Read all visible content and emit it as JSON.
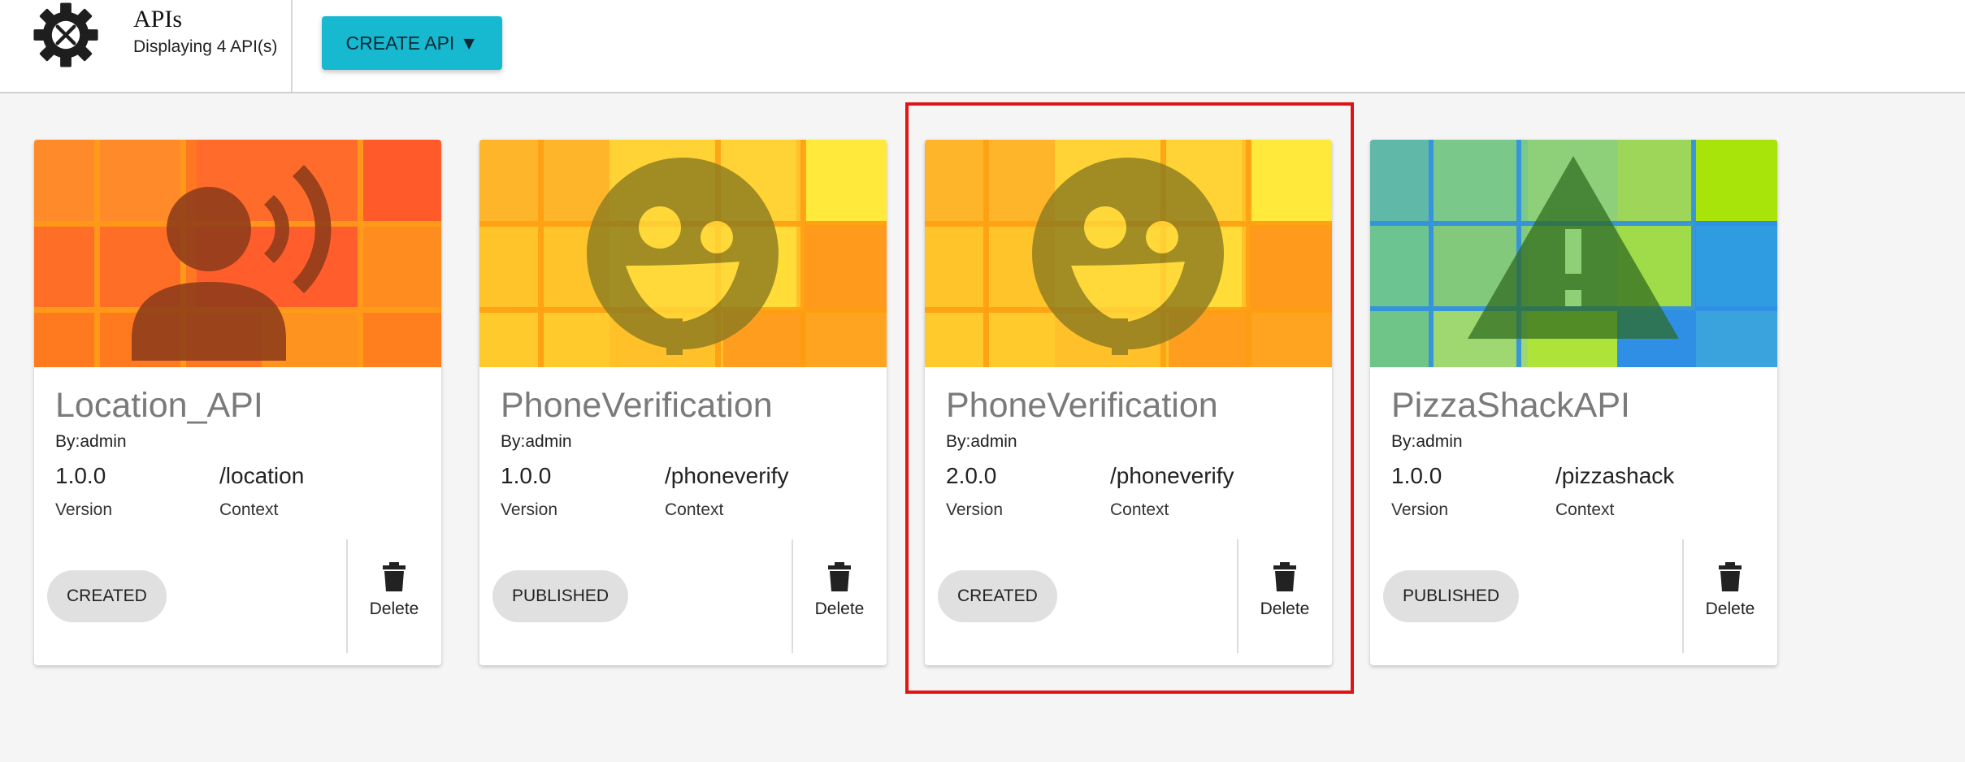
{
  "header": {
    "logo_icon": "gear-tools-icon",
    "title": "APIs",
    "subtitle": "Displaying 4 API(s)",
    "create_button_label": "CREATE API ▼"
  },
  "labels": {
    "version": "Version",
    "context": "Context",
    "delete": "Delete"
  },
  "cards": [
    {
      "name": "Location_API",
      "by": "By:admin",
      "version": "1.0.0",
      "context": "/location",
      "status": "CREATED",
      "thumbnail_icon": "person-broadcast-icon"
    },
    {
      "name": "PhoneVerification",
      "by": "By:admin",
      "version": "1.0.0",
      "context": "/phoneverify",
      "status": "PUBLISHED",
      "thumbnail_icon": "face-icon"
    },
    {
      "name": "PhoneVerification",
      "by": "By:admin",
      "version": "2.0.0",
      "context": "/phoneverify",
      "status": "CREATED",
      "thumbnail_icon": "face-icon",
      "highlighted": true
    },
    {
      "name": "PizzaShackAPI",
      "by": "By:admin",
      "version": "1.0.0",
      "context": "/pizzashack",
      "status": "PUBLISHED",
      "thumbnail_icon": "warning-icon"
    }
  ],
  "colors": {
    "create_button": "#17b9d1",
    "highlight_border": "#e01414",
    "status_chip": "#e0e0e0"
  }
}
